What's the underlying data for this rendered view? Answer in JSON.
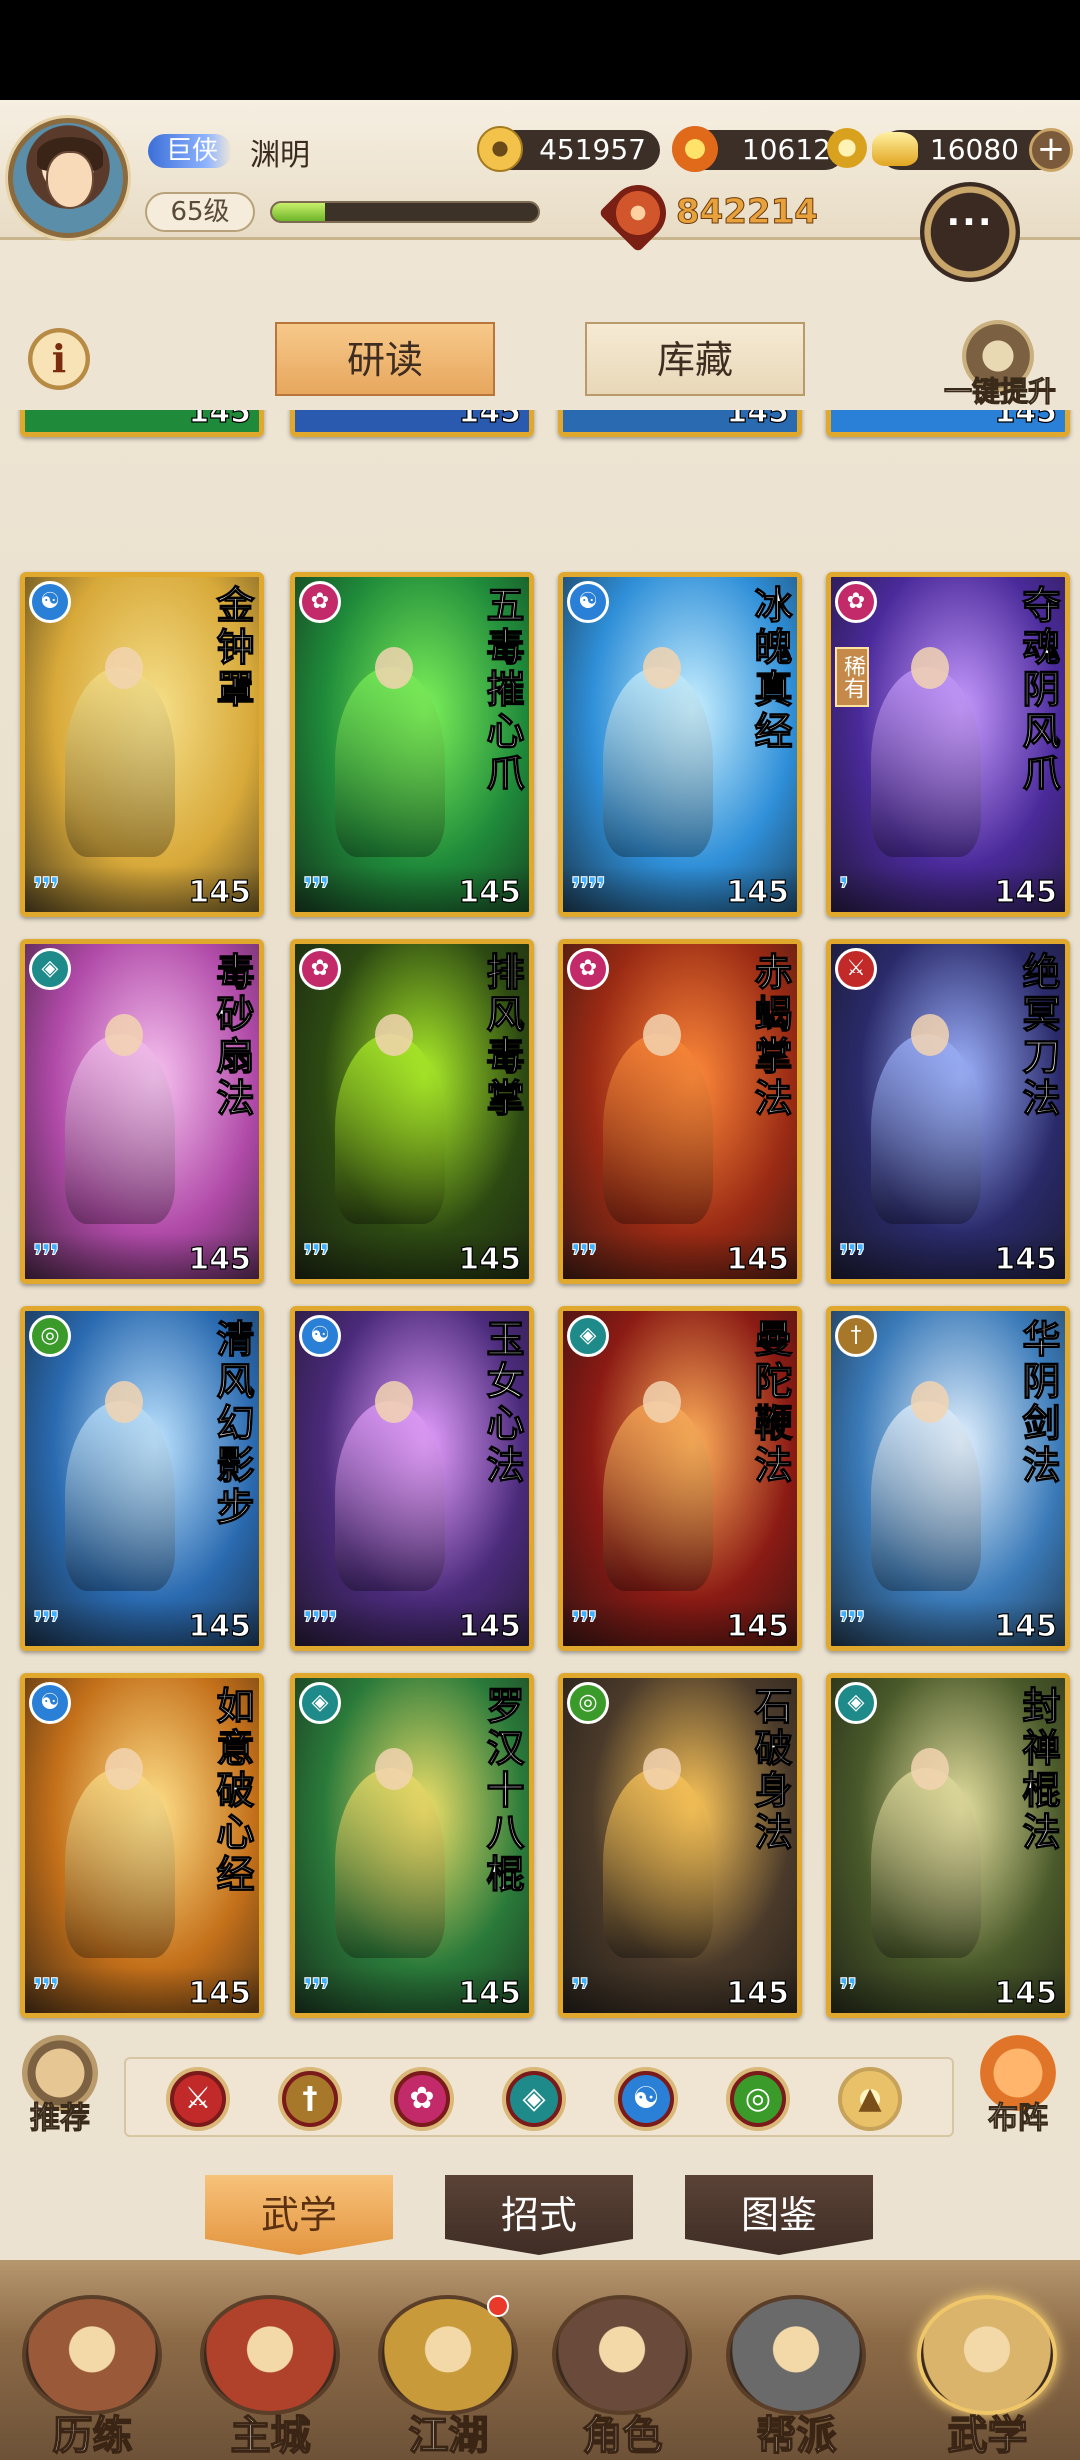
{
  "player": {
    "title_badge": "巨侠",
    "name": "渊明",
    "level": "65级",
    "exp_fraction": 0.2,
    "power": "842214"
  },
  "resources": {
    "coins": "451957",
    "jade": "10612",
    "gold": "16080",
    "add_label": "+"
  },
  "tabs": {
    "info": "i",
    "read": "研读",
    "store": "库藏",
    "one_click": "一键提升"
  },
  "partial_row": {
    "levels": [
      "145",
      "145",
      "145",
      "145"
    ]
  },
  "cards": [
    {
      "name": "金钟罩",
      "level": "145",
      "stars": "❜❜❜",
      "sect_icon": "taiji-icon",
      "sect_color": "#2a7fd6",
      "rare": "",
      "art_bg": "#d8a93a",
      "art_accent": "#f6e08a"
    },
    {
      "name": "五毒摧心爪",
      "level": "145",
      "stars": "❜❜❜",
      "sect_icon": "lotus-icon",
      "sect_color": "#c22a6a",
      "rare": "",
      "art_bg": "#1f8a3a",
      "art_accent": "#7ef25a"
    },
    {
      "name": "冰魄真经",
      "level": "145",
      "stars": "❜❜❜❜",
      "sect_icon": "taiji-icon",
      "sect_color": "#2a7fd6",
      "rare": "",
      "art_bg": "#2f8fd8",
      "art_accent": "#c9f0ff"
    },
    {
      "name": "夺魂阴风爪",
      "level": "145",
      "stars": "❜",
      "sect_icon": "lotus-icon",
      "sect_color": "#c22a6a",
      "rare": "稀有",
      "art_bg": "#4a2a9a",
      "art_accent": "#c79bff"
    },
    {
      "name": "毒砂扇法",
      "level": "145",
      "stars": "❜❜❜",
      "sect_icon": "fan-icon",
      "sect_color": "#1e8a8a",
      "rare": "",
      "art_bg": "#b04aa8",
      "art_accent": "#f7c2f0"
    },
    {
      "name": "排风毒掌",
      "level": "145",
      "stars": "❜❜❜",
      "sect_icon": "lotus-icon",
      "sect_color": "#c22a6a",
      "rare": "",
      "art_bg": "#2d4a12",
      "art_accent": "#aef02a"
    },
    {
      "name": "赤蝎掌法",
      "level": "145",
      "stars": "❜❜❜",
      "sect_icon": "lotus-icon",
      "sect_color": "#c22a6a",
      "rare": "",
      "art_bg": "#9a2a14",
      "art_accent": "#ff8a3a"
    },
    {
      "name": "绝冥刀法",
      "level": "145",
      "stars": "❜❜❜",
      "sect_icon": "blade-icon",
      "sect_color": "#c22a2a",
      "rare": "",
      "art_bg": "#2a2a6a",
      "art_accent": "#9fb4ff"
    },
    {
      "name": "清风幻影步",
      "level": "145",
      "stars": "❜❜❜",
      "sect_icon": "swirl-icon",
      "sect_color": "#3a9a2a",
      "rare": "",
      "art_bg": "#2a6ab0",
      "art_accent": "#bfe4ff"
    },
    {
      "name": "玉女心法",
      "level": "145",
      "stars": "❜❜❜❜",
      "sect_icon": "taiji-icon",
      "sect_color": "#2a7fd6",
      "rare": "",
      "art_bg": "#4a2a7a",
      "art_accent": "#e6a0ff"
    },
    {
      "name": "曼陀鞭法",
      "level": "145",
      "stars": "❜❜❜",
      "sect_icon": "fan-icon",
      "sect_color": "#1e8a8a",
      "rare": "",
      "art_bg": "#8a1a14",
      "art_accent": "#ffb05a"
    },
    {
      "name": "华阴剑法",
      "level": "145",
      "stars": "❜❜❜",
      "sect_icon": "sword-icon",
      "sect_color": "#a8782a",
      "rare": "",
      "art_bg": "#3a7ab8",
      "art_accent": "#e4f2ff"
    },
    {
      "name": "如意破心经",
      "level": "145",
      "stars": "❜❜❜",
      "sect_icon": "taiji-icon",
      "sect_color": "#2a7fd6",
      "rare": "",
      "art_bg": "#c4701a",
      "art_accent": "#ffe08a"
    },
    {
      "name": "罗汉十八棍",
      "level": "145",
      "stars": "❜❜❜",
      "sect_icon": "fan-icon",
      "sect_color": "#1e8a8a",
      "rare": "",
      "art_bg": "#2a7a3a",
      "art_accent": "#f0e06a"
    },
    {
      "name": "石破身法",
      "level": "145",
      "stars": "❜❜",
      "sect_icon": "swirl-icon",
      "sect_color": "#3a9a2a",
      "rare": "",
      "art_bg": "#4a3a2a",
      "art_accent": "#ffc85a"
    },
    {
      "name": "封禅棍法",
      "level": "145",
      "stars": "❜❜",
      "sect_icon": "fan-icon",
      "sect_color": "#1e8a8a",
      "rare": "",
      "art_bg": "#4a5a2a",
      "art_accent": "#e6e0a0"
    }
  ],
  "filter": {
    "recommend_label": "推荐",
    "formation_label": "布阵",
    "buttons": [
      {
        "icon": "blade-icon",
        "color": "#c22a2a"
      },
      {
        "icon": "sword-icon",
        "color": "#a8782a"
      },
      {
        "icon": "lotus-icon",
        "color": "#c22a6a"
      },
      {
        "icon": "fan-icon",
        "color": "#1e8a8a"
      },
      {
        "icon": "taiji-icon",
        "color": "#2a7fd6"
      },
      {
        "icon": "swirl-icon",
        "color": "#3a9a2a"
      },
      {
        "icon": "arrow-up-icon",
        "color": "#e8c168"
      }
    ]
  },
  "subtabs": [
    "武学",
    "招式",
    "图鉴"
  ],
  "nav": [
    {
      "label": "历练",
      "icon": "training-icon",
      "color": "#9a5a3a",
      "dot": false
    },
    {
      "label": "主城",
      "icon": "city-icon",
      "color": "#b0412a",
      "dot": false
    },
    {
      "label": "江湖",
      "icon": "jianghu-icon",
      "color": "#c89a3a",
      "dot": true
    },
    {
      "label": "角色",
      "icon": "character-icon",
      "color": "#6a4a3a",
      "dot": false
    },
    {
      "label": "帮派",
      "icon": "guild-icon",
      "color": "#6a6a6a",
      "dot": false
    },
    {
      "label": "武学",
      "icon": "scroll-icon",
      "color": "#d9b46a",
      "dot": false
    }
  ]
}
